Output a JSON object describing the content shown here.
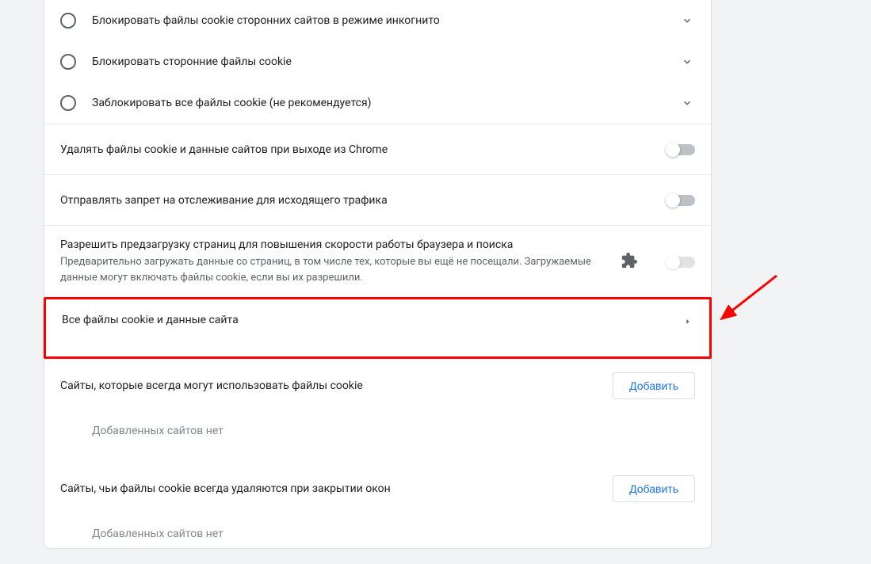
{
  "radios": [
    {
      "label": "Блокировать файлы cookie сторонних сайтов в режиме инкогнито"
    },
    {
      "label": "Блокировать сторонние файлы cookie"
    },
    {
      "label": "Заблокировать все файлы cookie (не рекомендуется)"
    }
  ],
  "toggles": {
    "clear_on_exit": "Удалять файлы cookie и данные сайтов при выходе из Chrome",
    "do_not_track": "Отправлять запрет на отслеживание для исходящего трафика",
    "preload_title": "Разрешить предзагрузку страниц для повышения скорости работы браузера и поиска",
    "preload_sub": "Предварительно загружать данные со страниц, в том числе тех, которые вы ещё не посещали. Загружаемые данные могут включать файлы cookie, если вы их разрешили."
  },
  "all_cookies": "Все файлы cookie и данные сайта",
  "allow_section": {
    "title": "Сайты, которые всегда могут использовать файлы cookie",
    "button": "Добавить",
    "empty": "Добавленных сайтов нет"
  },
  "clear_section": {
    "title": "Сайты, чьи файлы cookie всегда удаляются при закрытии окон",
    "button": "Добавить",
    "empty": "Добавленных сайтов нет"
  }
}
